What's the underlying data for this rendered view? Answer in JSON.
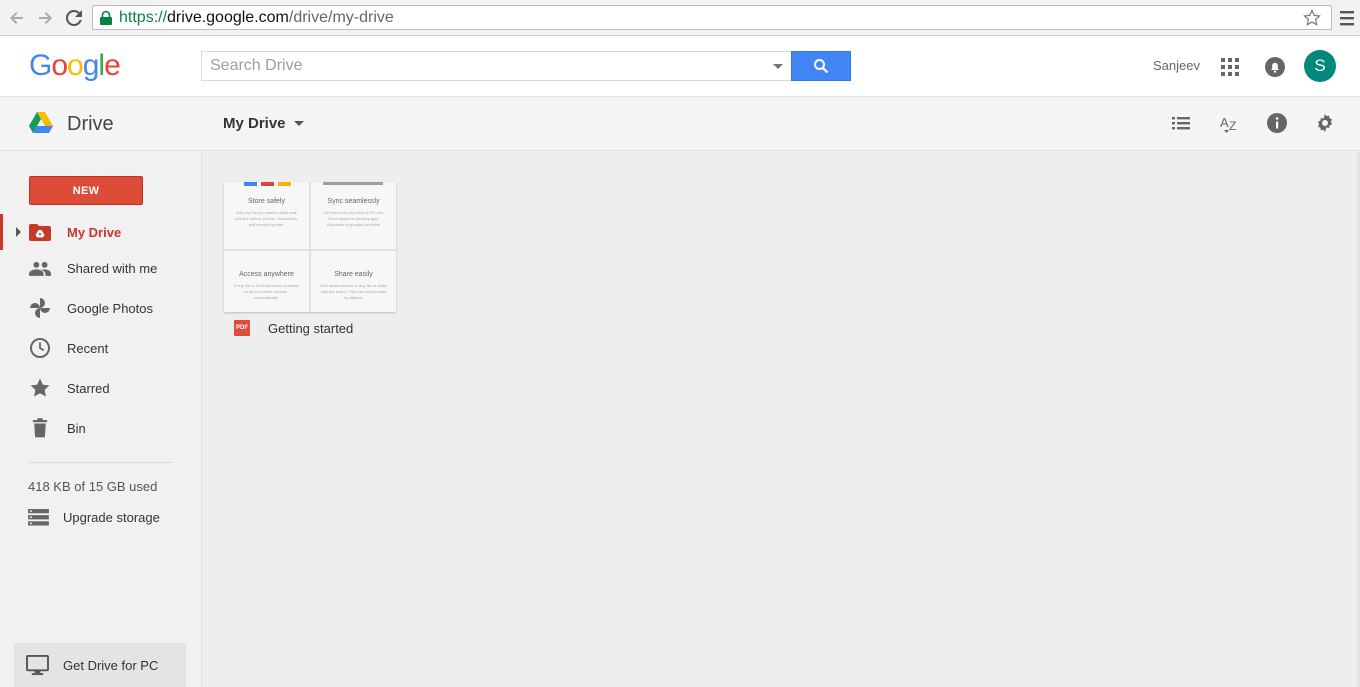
{
  "browser": {
    "url_scheme": "https://",
    "url_host": "drive.google.com",
    "url_path": "/drive/my-drive",
    "icons": [
      "back-arrow-icon",
      "forward-arrow-icon",
      "reload-icon",
      "lock-icon",
      "bookmark-star-icon",
      "chrome-menu-icon"
    ]
  },
  "header": {
    "logo_letters": [
      "G",
      "o",
      "o",
      "g",
      "l",
      "e"
    ],
    "logo_colors": [
      "#4285f4",
      "#ea4335",
      "#fbbc05",
      "#4285f4",
      "#34a853",
      "#ea4335"
    ],
    "search_placeholder": "Search Drive",
    "user_name": "Sanjeev",
    "avatar_letter": "S",
    "avatar_color": "#00897b",
    "search_button_color": "#4285f4"
  },
  "toolbar": {
    "app_name": "Drive",
    "location_label": "My Drive",
    "icons": [
      "list-view-icon",
      "sort-az-icon",
      "info-icon",
      "settings-gear-icon"
    ]
  },
  "sidebar": {
    "new_label": "NEW",
    "new_color": "#dd4b39",
    "items": [
      {
        "label": "My Drive",
        "icon": "my-drive-icon",
        "active": true
      },
      {
        "label": "Shared with me",
        "icon": "people-icon"
      },
      {
        "label": "Google Photos",
        "icon": "pinwheel-icon"
      },
      {
        "label": "Recent",
        "icon": "clock-icon"
      },
      {
        "label": "Starred",
        "icon": "star-icon"
      },
      {
        "label": "Bin",
        "icon": "trash-icon"
      }
    ],
    "storage_text": "418 KB of 15 GB used",
    "upgrade_label": "Upgrade storage",
    "get_drive_label": "Get Drive for PC",
    "active_color": "#c53929"
  },
  "files": [
    {
      "name": "Getting started",
      "type_badge": "PDF",
      "thumbnail": {
        "cells": [
          {
            "title": "Store safely",
            "desc": "Add any file you want to keep safe with the button: photos, documents, and everything else."
          },
          {
            "title": "Sync seamlessly",
            "desc": "Get files from your Mac or PC into Drive using the desktop app. Download at google.com/drive"
          },
          {
            "title": "Access anywhere",
            "desc": "Every file in Drive becomes available on all your other devices - automatically."
          },
          {
            "title": "Share easily",
            "desc": "Give others access to any file or folder with the button. Files are kept private by default."
          }
        ]
      }
    }
  ]
}
